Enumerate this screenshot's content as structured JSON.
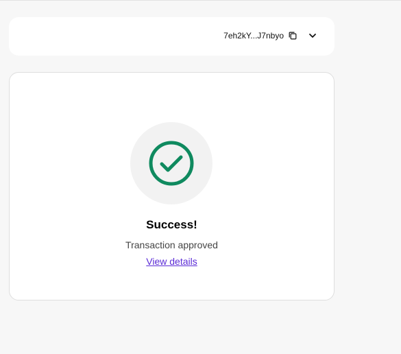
{
  "wallet": {
    "address_short": "7eh2kY...J7nbyo",
    "copy_icon": "copy-icon",
    "dropdown_icon": "chevron-down-icon"
  },
  "status": {
    "icon": "check-circle-icon",
    "icon_color": "#0f8a5f",
    "title": "Success!",
    "message": "Transaction approved",
    "details_link_label": "View details",
    "link_color": "#5b2bd6"
  }
}
